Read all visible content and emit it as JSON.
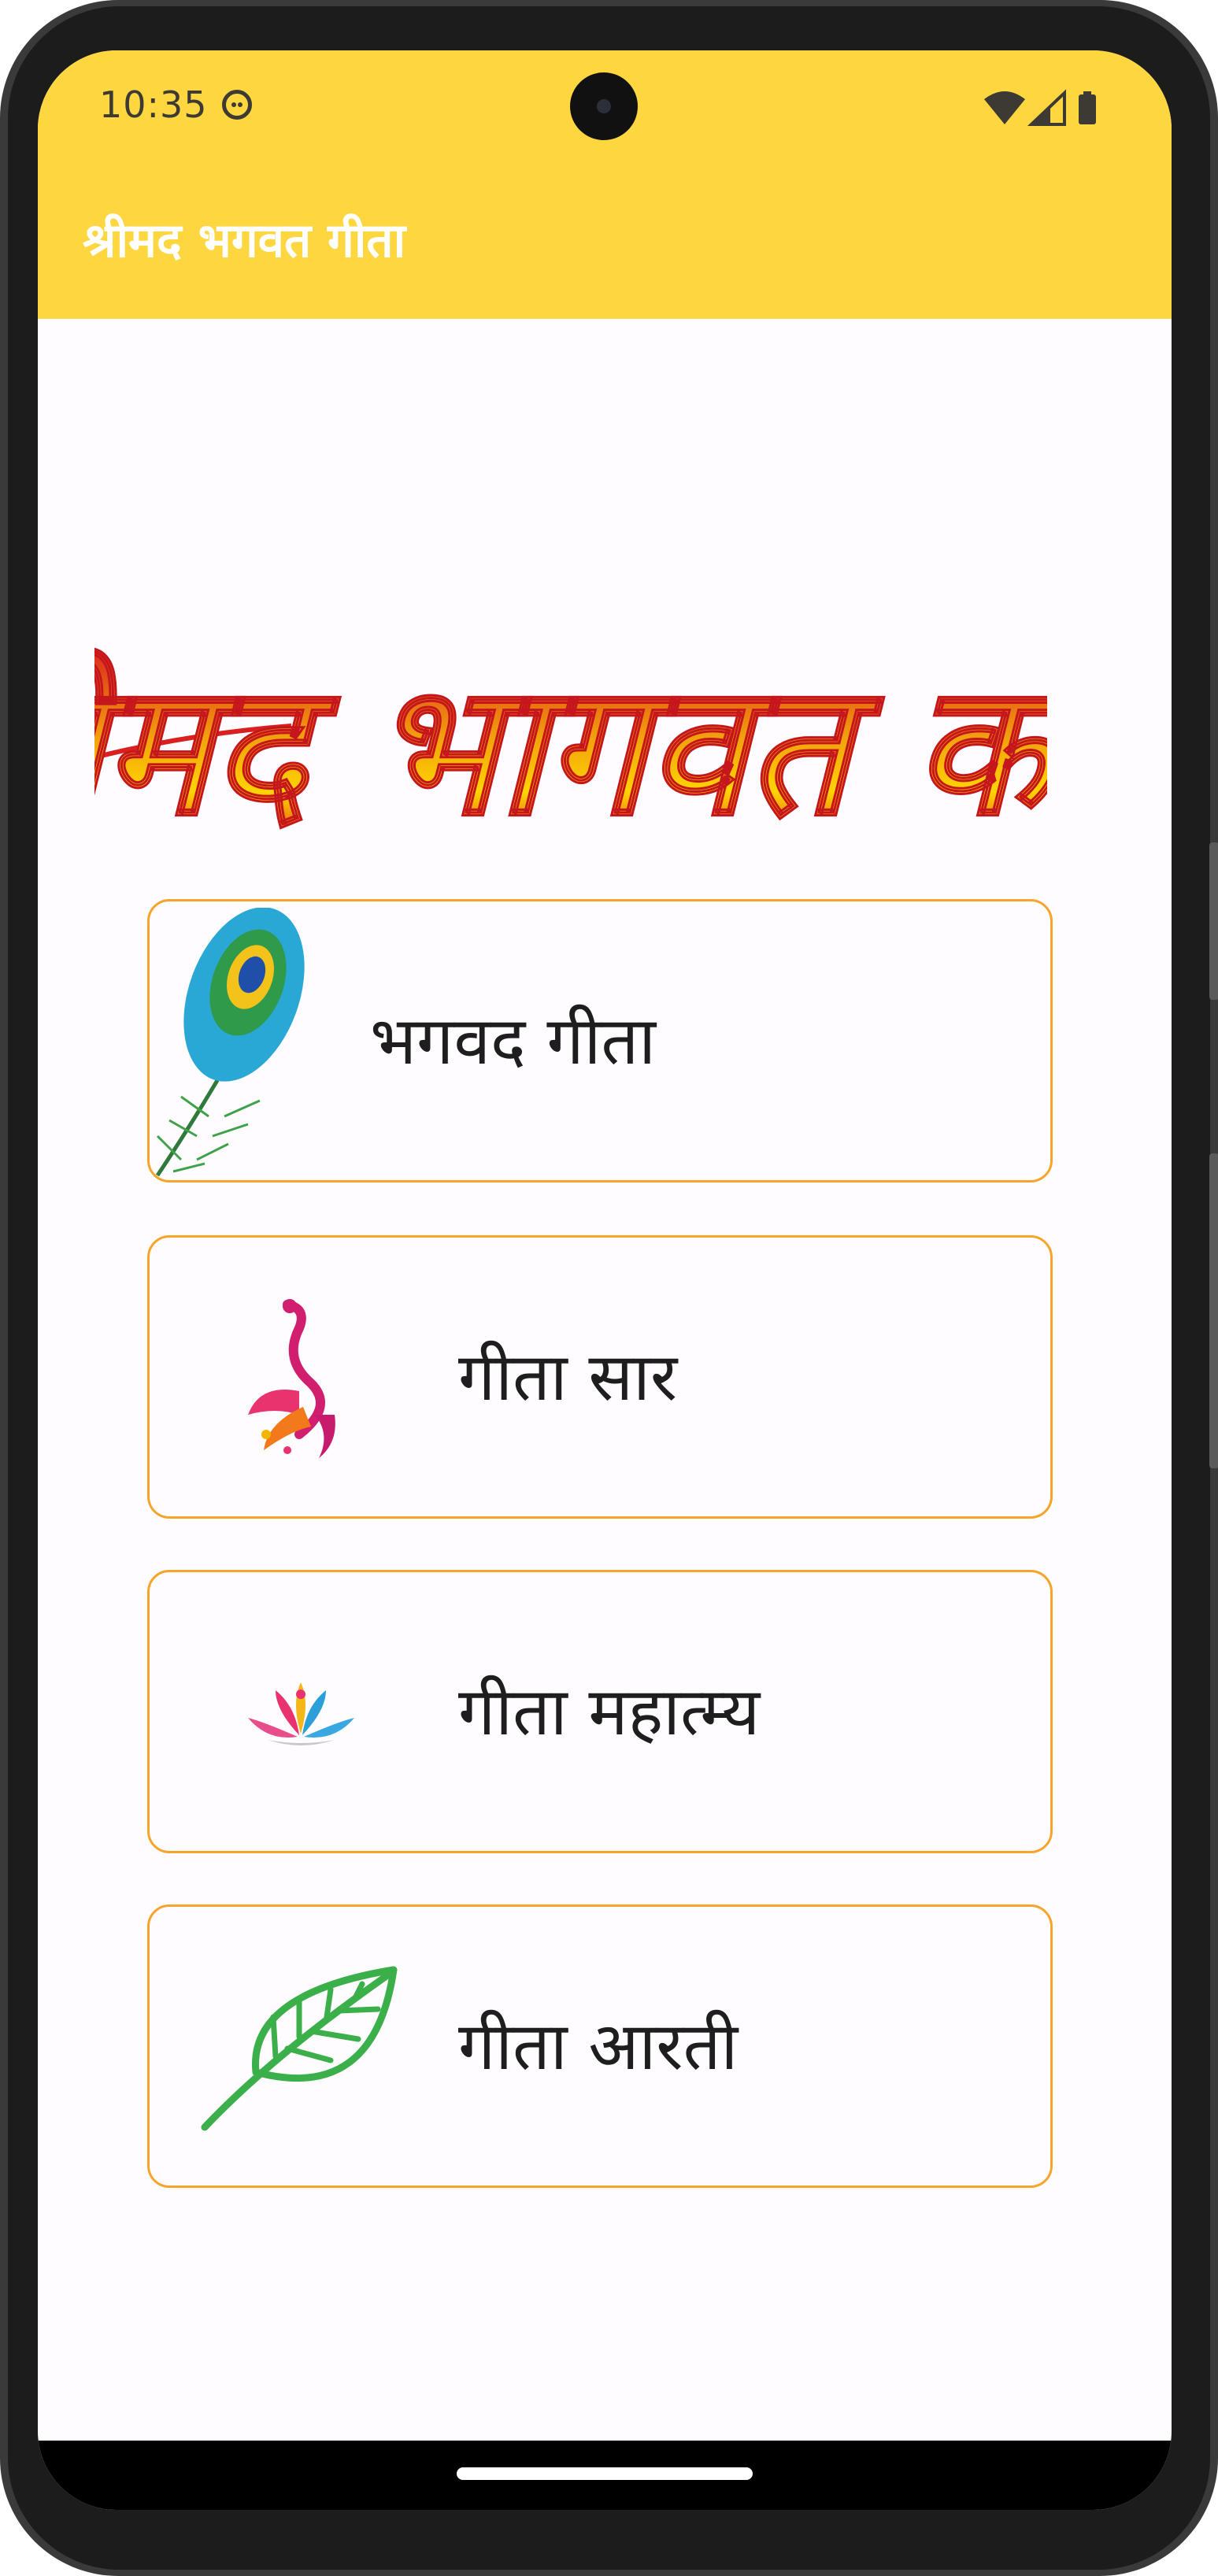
{
  "status_bar": {
    "time": "10:35",
    "icons": [
      "cat-face-icon",
      "wifi-icon",
      "cellular-signal-icon",
      "battery-icon"
    ]
  },
  "app_bar": {
    "title": "श्रीमद भगवत गीता",
    "background_color": "#fdd640"
  },
  "banner": {
    "text": "श्रीमद भागवत कथा",
    "colors": [
      "#d91f1f",
      "#f2a20c",
      "#ffd400"
    ]
  },
  "menu": {
    "border_color": "#f7a42a",
    "items": [
      {
        "label": "भगवद गीता",
        "icon": "peacock-feather-icon"
      },
      {
        "label": "गीता सार",
        "icon": "peacock-icon"
      },
      {
        "label": "गीता महात्म्य",
        "icon": "lotus-icon"
      },
      {
        "label": "गीता आरती",
        "icon": "leaf-icon"
      }
    ]
  }
}
